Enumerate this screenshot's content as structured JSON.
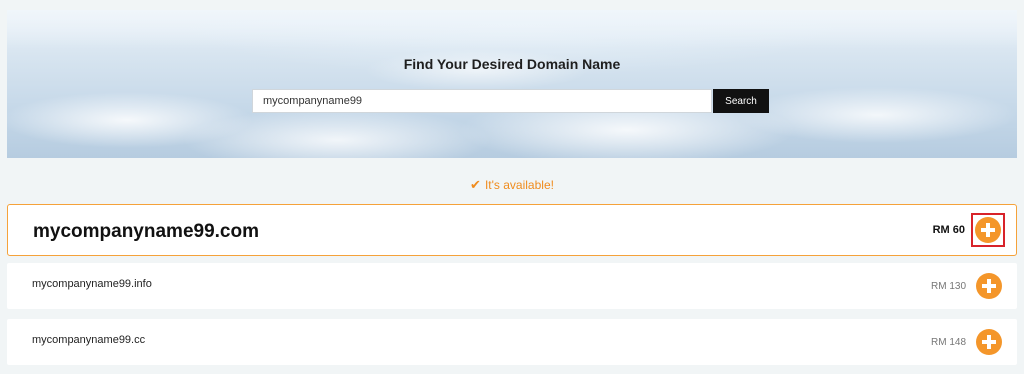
{
  "hero": {
    "title": "Find Your Desired Domain Name",
    "search_value": "mycompanyname99",
    "search_button_label": "Search"
  },
  "status": {
    "icon": "check-icon",
    "text": "It's available!",
    "color": "#f08c1e"
  },
  "results": [
    {
      "domain": "mycompanyname99.com",
      "price": "RM 60",
      "featured": true
    },
    {
      "domain": "mycompanyname99.info",
      "price": "RM 130",
      "featured": false
    },
    {
      "domain": "mycompanyname99.cc",
      "price": "RM 148",
      "featured": false
    }
  ],
  "colors": {
    "accent": "#f4962a",
    "highlight": "#d8232a",
    "background": "#f1f5f6"
  }
}
